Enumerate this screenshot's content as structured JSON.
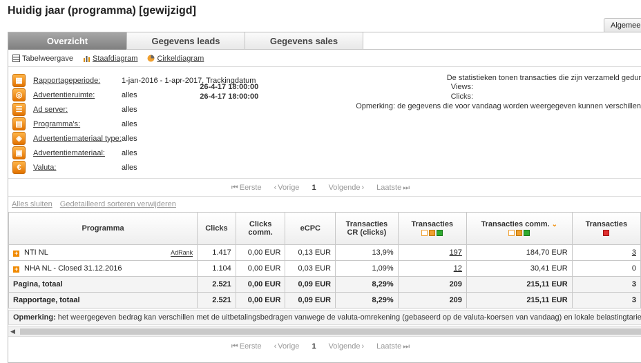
{
  "page_title": "Huidig jaar (programma) [gewijzigd]",
  "right_tab": "Algemee",
  "tabs": [
    {
      "label": "Overzicht"
    },
    {
      "label": "Gegevens leads"
    },
    {
      "label": "Gegevens sales"
    }
  ],
  "views": {
    "table": "Tabelweergave",
    "bar": "Staafdiagram",
    "pie": "Cirkeldiagram"
  },
  "params": [
    {
      "label": "Rapportageperiode:",
      "value": "1-jan-2016 - 1-apr-2017, Trackingdatum"
    },
    {
      "label": "Advertentieruimte:",
      "value": "alles"
    },
    {
      "label": "Ad server:",
      "value": "alles"
    },
    {
      "label": "Programma's:",
      "value": "alles"
    },
    {
      "label": "Advertentiemateriaal type:",
      "value": "alles"
    },
    {
      "label": "Advertentiemateriaal:",
      "value": "alles"
    },
    {
      "label": "Valuta:",
      "value": "alles"
    }
  ],
  "stats": {
    "intro": "De statistieken tonen transacties die zijn verzameld gedur",
    "views_label": "Views:",
    "views_value": "26-4-17 18:00:00",
    "clicks_label": "Clicks:",
    "clicks_value": "26-4-17 18:00:00",
    "note": "Opmerking: de gegevens die voor vandaag worden weergegeven kunnen verschillen"
  },
  "pager": {
    "first": "Eerste",
    "prev": "Vorige",
    "current": "1",
    "next": "Volgende",
    "last": "Laatste"
  },
  "links": {
    "collapse": "Alles sluiten",
    "clear_sort": "Gedetailleerd sorteren verwijderen"
  },
  "table": {
    "headers": {
      "program": "Programma",
      "clicks": "Clicks",
      "clicks_comm_1": "Clicks",
      "clicks_comm_2": "comm.",
      "ecpc": "eCPC",
      "cr_1": "Transacties",
      "cr_2": "CR (clicks)",
      "transactions": "Transacties",
      "trans_comm": "Transacties comm.",
      "transactions_2": "Transacties"
    },
    "rows": [
      {
        "name": "NTI NL",
        "badge": "AdRank",
        "clicks": "1.417",
        "clicks_comm": "0,00 EUR",
        "ecpc": "0,13 EUR",
        "cr": "13,9%",
        "transactions": "197",
        "trans_comm": "184,70 EUR",
        "transactions_2": "3"
      },
      {
        "name": "NHA NL - Closed 31.12.2016",
        "clicks": "1.104",
        "clicks_comm": "0,00 EUR",
        "ecpc": "0,03 EUR",
        "cr": "1,09%",
        "transactions": "12",
        "trans_comm": "30,41 EUR",
        "transactions_2": "0"
      }
    ],
    "totals": [
      {
        "name": "Pagina, totaal",
        "clicks": "2.521",
        "clicks_comm": "0,00 EUR",
        "ecpc": "0,09 EUR",
        "cr": "8,29%",
        "transactions": "209",
        "trans_comm": "215,11 EUR",
        "transactions_2": "3"
      },
      {
        "name": "Rapportage, totaal",
        "clicks": "2.521",
        "clicks_comm": "0,00 EUR",
        "ecpc": "0,09 EUR",
        "cr": "8,29%",
        "transactions": "209",
        "trans_comm": "215,11 EUR",
        "transactions_2": "3"
      }
    ]
  },
  "remark": {
    "label": "Opmerking:",
    "text": "het weergegeven bedrag kan verschillen met de uitbetalingsbedragen vanwege de valuta-omrekening (gebaseerd op de valuta-koersen van vandaag) en lokale belastingtariev"
  },
  "colors": {
    "accent": "#f08a00",
    "tab_active": "#8f8f8f",
    "status_open": "#f0a030",
    "status_ok": "#2faa2f",
    "status_cancel": "#e03030"
  }
}
